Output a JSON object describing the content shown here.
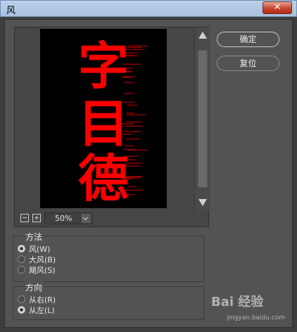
{
  "window": {
    "title": "风",
    "close_icon": "close-icon",
    "close_glyph": "✕"
  },
  "preview": {
    "canvas_text": [
      "字",
      "目",
      "德"
    ],
    "text_color": "#ff0000",
    "zoom": {
      "minus": "−",
      "plus": "+",
      "value": "50%"
    }
  },
  "buttons": {
    "ok": "确定",
    "reset": "复位"
  },
  "method": {
    "legend": "方法",
    "options": [
      {
        "label": "风(W)",
        "selected": true
      },
      {
        "label": "大风(B)",
        "selected": false
      },
      {
        "label": "飓风(S)",
        "selected": false
      }
    ]
  },
  "direction": {
    "legend": "方向",
    "options": [
      {
        "label": "从右(R)",
        "selected": false
      },
      {
        "label": "从左(L)",
        "selected": true
      }
    ]
  },
  "watermark": {
    "brand": "Bai 经验",
    "url": "jingyan.baidu.com"
  }
}
